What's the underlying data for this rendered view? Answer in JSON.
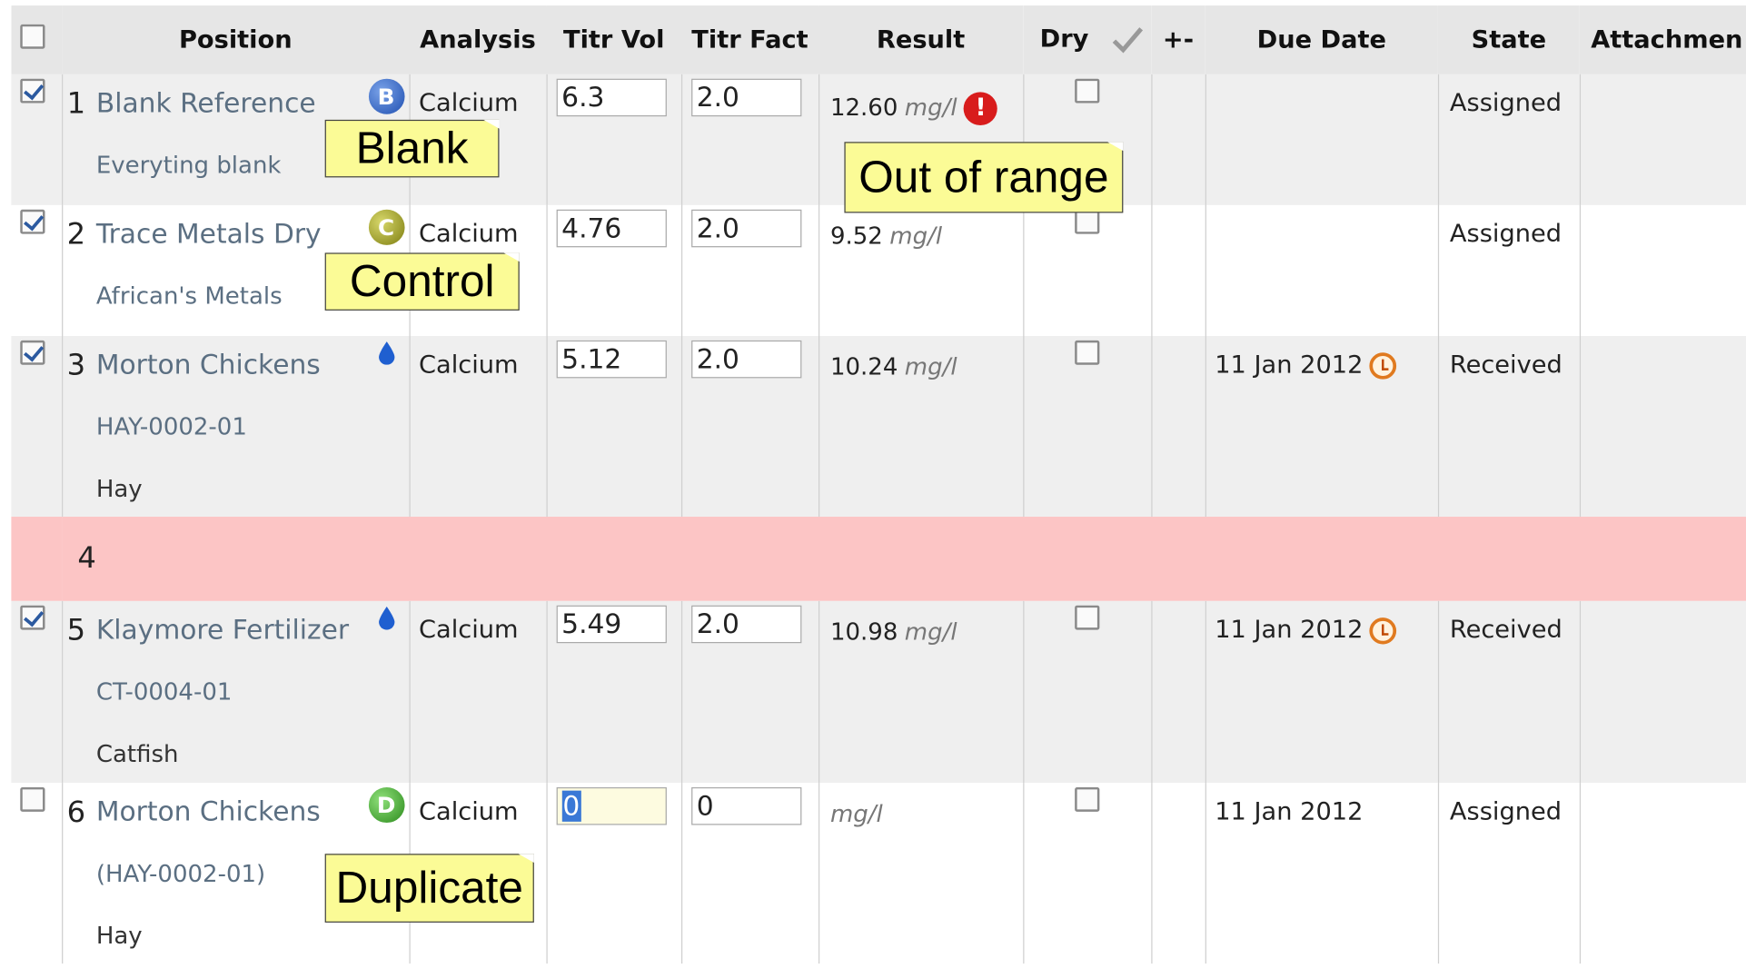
{
  "header": {
    "position": "Position",
    "analysis": "Analysis",
    "titr_vol": "Titr Vol",
    "titr_fact": "Titr Fact",
    "result": "Result",
    "dry": "Dry",
    "check_icon": "checkmark-icon",
    "plusminus": "+-",
    "due_date": "Due Date",
    "state": "State",
    "attachments": "Attachmen"
  },
  "rows": [
    {
      "pos": "1",
      "name": "Blank Reference",
      "icon": "blank-icon",
      "icon_letter": "B",
      "sub1": "Everyting blank",
      "sub2": "",
      "analysis": "Calcium",
      "titr_vol": "6.3",
      "titr_fact": "2.0",
      "result": "12.60",
      "unit": "mg/l",
      "out_of_range": true,
      "due": "",
      "state": "Assigned",
      "selected": true
    },
    {
      "pos": "2",
      "name": "Trace Metals Dry",
      "icon": "control-icon",
      "icon_letter": "C",
      "sub1": "African's Metals",
      "sub2": "",
      "analysis": "Calcium",
      "titr_vol": "4.76",
      "titr_fact": "2.0",
      "result": "9.52",
      "unit": "mg/l",
      "due": "",
      "state": "Assigned",
      "selected": true
    },
    {
      "pos": "3",
      "name": "Morton Chickens",
      "icon": "drop-icon",
      "sub1": "HAY-0002-01",
      "sub2": "Hay",
      "analysis": "Calcium",
      "titr_vol": "5.12",
      "titr_fact": "2.0",
      "result": "10.24",
      "unit": "mg/l",
      "due": "11 Jan 2012",
      "state": "Received",
      "selected": true
    },
    {
      "pos": "4"
    },
    {
      "pos": "5",
      "name": "Klaymore Fertilizer",
      "icon": "drop-icon",
      "sub1": "CT-0004-01",
      "sub2": "Catfish",
      "analysis": "Calcium",
      "titr_vol": "5.49",
      "titr_fact": "2.0",
      "result": "10.98",
      "unit": "mg/l",
      "due": "11 Jan 2012",
      "state": "Received",
      "selected": true
    },
    {
      "pos": "6",
      "name": "Morton Chickens",
      "icon": "duplicate-icon",
      "icon_letter": "D",
      "sub1": "(HAY-0002-01)",
      "sub2": "Hay",
      "analysis": "Calcium",
      "titr_vol": "0",
      "titr_fact": "0",
      "result": "",
      "unit": "mg/l",
      "due": "11 Jan 2012",
      "state": "Assigned",
      "selected": false
    }
  ],
  "notes": {
    "blank": "Blank",
    "control": "Control",
    "out_of_range": "Out of range",
    "duplicate": "Duplicate"
  },
  "warning_symbol": "!",
  "colors": {
    "header_bg": "#e6e6e6",
    "row_alt_bg": "#efefef",
    "empty_slot_bg": "#fcc5c5",
    "note_bg": "#fbfb96",
    "link_text": "#5b6f82",
    "warning": "#d81c1c"
  }
}
